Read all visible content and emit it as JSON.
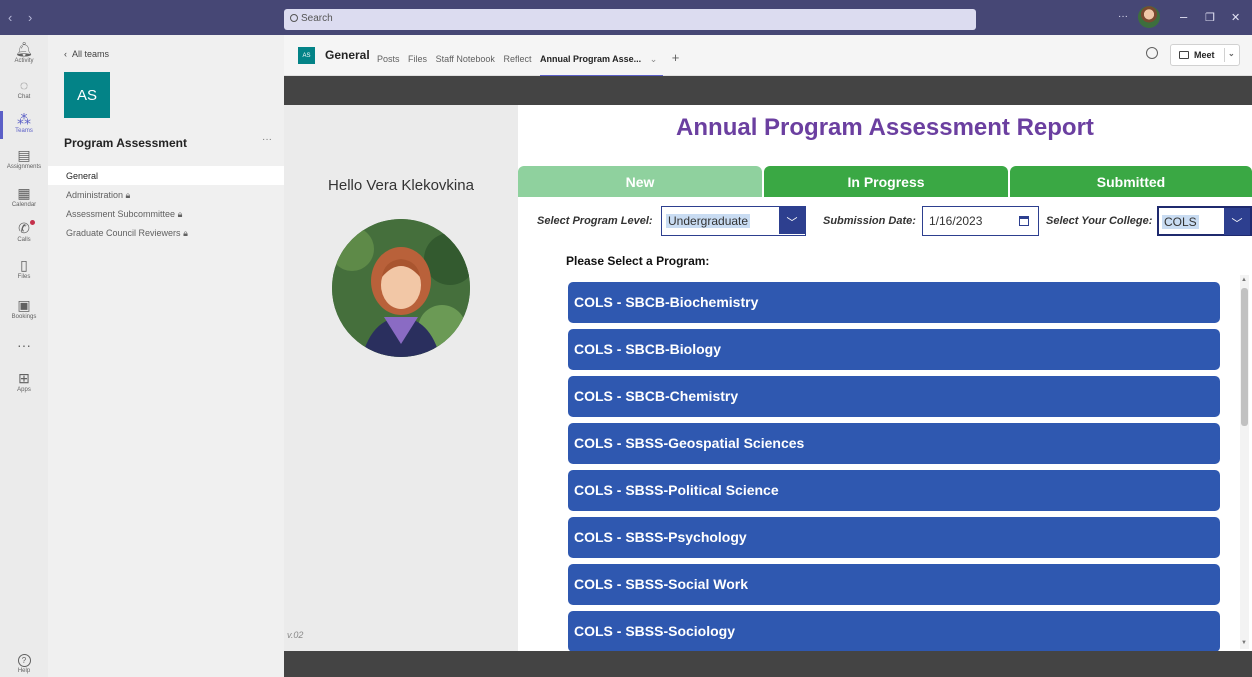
{
  "titlebar": {
    "nav": "‹ ›",
    "search_placeholder": "Search",
    "more": "···",
    "minimize": "–",
    "restore": "❐",
    "close": "✕"
  },
  "rail": {
    "items": [
      {
        "label": "Activity",
        "icon": "bell-icon"
      },
      {
        "label": "Chat",
        "icon": "chat-icon"
      },
      {
        "label": "Teams",
        "icon": "teams-icon",
        "active": true
      },
      {
        "label": "Assignments",
        "icon": "assignments-icon"
      },
      {
        "label": "Calendar",
        "icon": "calendar-icon"
      },
      {
        "label": "Calls",
        "icon": "phone-icon"
      },
      {
        "label": "Files",
        "icon": "file-icon"
      },
      {
        "label": "Bookings",
        "icon": "bookings-icon"
      },
      {
        "label": "",
        "icon": "more-icon"
      },
      {
        "label": "Apps",
        "icon": "apps-icon"
      }
    ],
    "help_label": "Help"
  },
  "team_panel": {
    "all_teams": "All teams",
    "avatar": "AS",
    "team_name": "Program Assessment",
    "more": "···",
    "channels": [
      {
        "label": "General",
        "locked": false,
        "active": true
      },
      {
        "label": "Administration",
        "locked": true
      },
      {
        "label": "Assessment Subcommittee",
        "locked": true
      },
      {
        "label": "Graduate Council Reviewers",
        "locked": true
      }
    ]
  },
  "channel_header": {
    "avatar": "AS",
    "name": "General",
    "tabs": [
      "Posts",
      "Files",
      "Staff Notebook",
      "Reflect"
    ],
    "active_tab": "Annual Program Asse...",
    "add_tab": "+",
    "meet_label": "Meet"
  },
  "app": {
    "title": "Annual Program Assessment Report",
    "greeting": "Hello Vera Klekovkina",
    "version": "v.02",
    "status_tabs": [
      {
        "label": "New",
        "color": "#8fd19e"
      },
      {
        "label": "In Progress",
        "color": "#3aa844"
      },
      {
        "label": "Submitted",
        "color": "#3aa844"
      }
    ],
    "filters": {
      "program_level_label": "Select Program Level:",
      "program_level_value": "Undergraduate",
      "submission_date_label": "Submission Date:",
      "submission_date_value": "1/16/2023",
      "college_label": "Select Your College:",
      "college_value": "COLS"
    },
    "select_program_label": "Please Select a Program:",
    "programs": [
      "COLS - SBCB-Biochemistry",
      "COLS - SBCB-Biology",
      "COLS - SBCB-Chemistry",
      "COLS - SBSS-Geospatial Sciences",
      "COLS - SBSS-Political Science",
      "COLS - SBSS-Psychology",
      "COLS - SBSS-Social Work",
      "COLS - SBSS-Sociology"
    ],
    "colors": {
      "title": "#6b3fa0",
      "program_button": "#2f58b0",
      "filter_border": "#2d3f8f"
    }
  }
}
